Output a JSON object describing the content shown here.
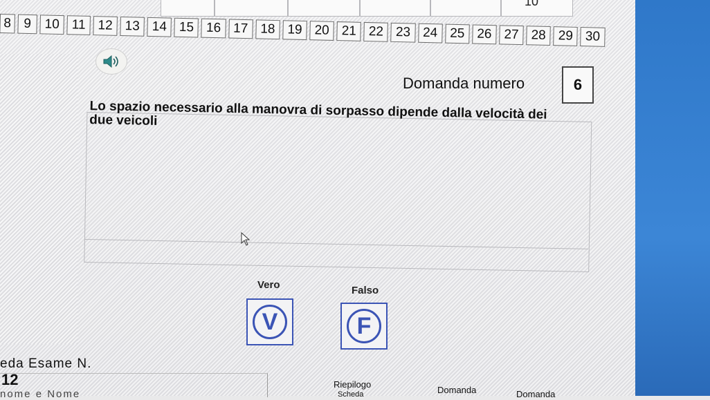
{
  "question_numbers": [
    "8",
    "9",
    "10",
    "11",
    "12",
    "13",
    "14",
    "15",
    "16",
    "17",
    "18",
    "19",
    "20",
    "21",
    "22",
    "23",
    "24",
    "25",
    "26",
    "27",
    "28",
    "29",
    "30"
  ],
  "top_partial_label": "10",
  "audio": {
    "icon": "speaker-icon"
  },
  "question": {
    "label": "Domanda numero",
    "number": "6",
    "text": "Lo spazio necessario alla manovra di sorpasso dipende dalla velocità dei due veicoli"
  },
  "answers": {
    "true_label": "Vero",
    "true_symbol": "V",
    "false_label": "Falso",
    "false_symbol": "F"
  },
  "exam": {
    "sheet_label": "eda Esame N.",
    "sheet_number": "12",
    "name_label": "nome e Nome"
  },
  "bottom_nav": {
    "summary_label": "Riepilogo",
    "summary_sub": "Scheda",
    "question_prev_label": "Domanda",
    "question_next_label": "Domanda"
  },
  "colors": {
    "answer_blue": "#3b54b5",
    "screen_edge_blue": "#2f78c9"
  }
}
